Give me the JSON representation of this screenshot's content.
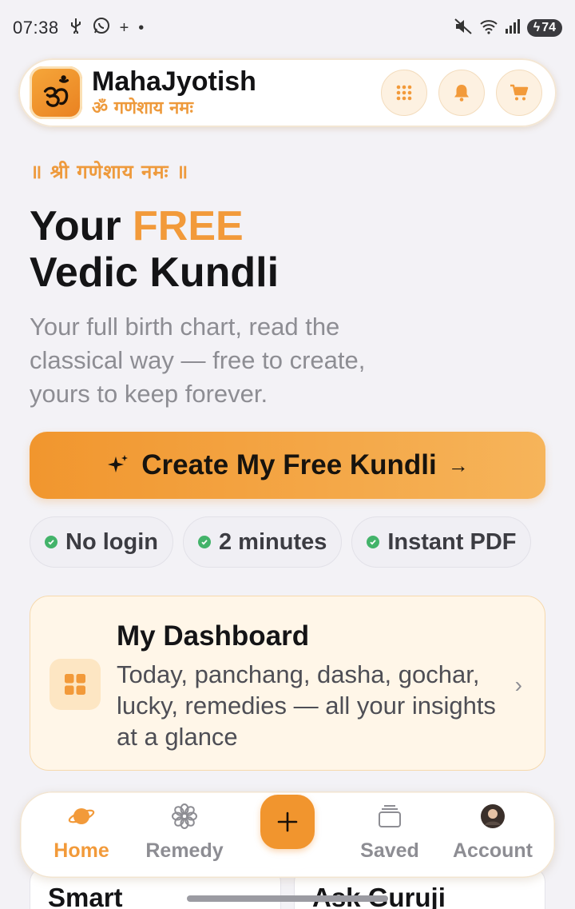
{
  "status_bar": {
    "time": "07:38",
    "left_icons": [
      "usb-icon",
      "whatsapp-icon",
      "plus-icon",
      "dot-icon"
    ],
    "right_icons": [
      "mute-icon",
      "wifi-icon",
      "signal-icon"
    ],
    "battery": "74"
  },
  "header": {
    "logo_icon": "om-icon",
    "brand_name": "MahaJyotish",
    "brand_tagline": "ॐ गणेशाय नमः",
    "actions": [
      {
        "name": "apps-grid-button",
        "icon": "grid-icon"
      },
      {
        "name": "notifications-button",
        "icon": "bell-icon"
      },
      {
        "name": "cart-button",
        "icon": "cart-icon"
      }
    ]
  },
  "hero": {
    "mantra": "॥ श्री गणेशाय नमः ॥",
    "title_part1": "Your ",
    "title_highlight": "FREE",
    "title_line2": "Vedic Kundli",
    "subtitle": "Your full birth chart, read the classical way — free to create, yours to keep forever."
  },
  "cta": {
    "label": "Create My Free Kundli",
    "arrow": "→",
    "icon": "sparkle-icon"
  },
  "chips": [
    {
      "label": "No login"
    },
    {
      "label": "2 minutes"
    },
    {
      "label": "Instant PDF"
    }
  ],
  "dashboard_card": {
    "title": "My Dashboard",
    "description": "Today, panchang, dasha, gochar, lucky, remedies — all your insights at a glance",
    "icon": "dashboard-grid-icon",
    "chevron": "›"
  },
  "feature_cards": [
    {
      "label": "Smart"
    },
    {
      "label": "Ask Guruji"
    }
  ],
  "bottom_nav": {
    "items": [
      {
        "label": "Home",
        "icon": "planet-icon",
        "active": true
      },
      {
        "label": "Remedy",
        "icon": "flower-icon",
        "active": false
      },
      {
        "label": "Saved",
        "icon": "stack-icon",
        "active": false
      },
      {
        "label": "Account",
        "icon": "avatar-icon",
        "active": false
      }
    ],
    "fab": {
      "icon": "plus-icon",
      "symbol": "+"
    }
  },
  "colors": {
    "accent": "#f29a3a",
    "background": "#f3f2f6",
    "card_warm": "#fff6e8",
    "success": "#43b36a"
  }
}
